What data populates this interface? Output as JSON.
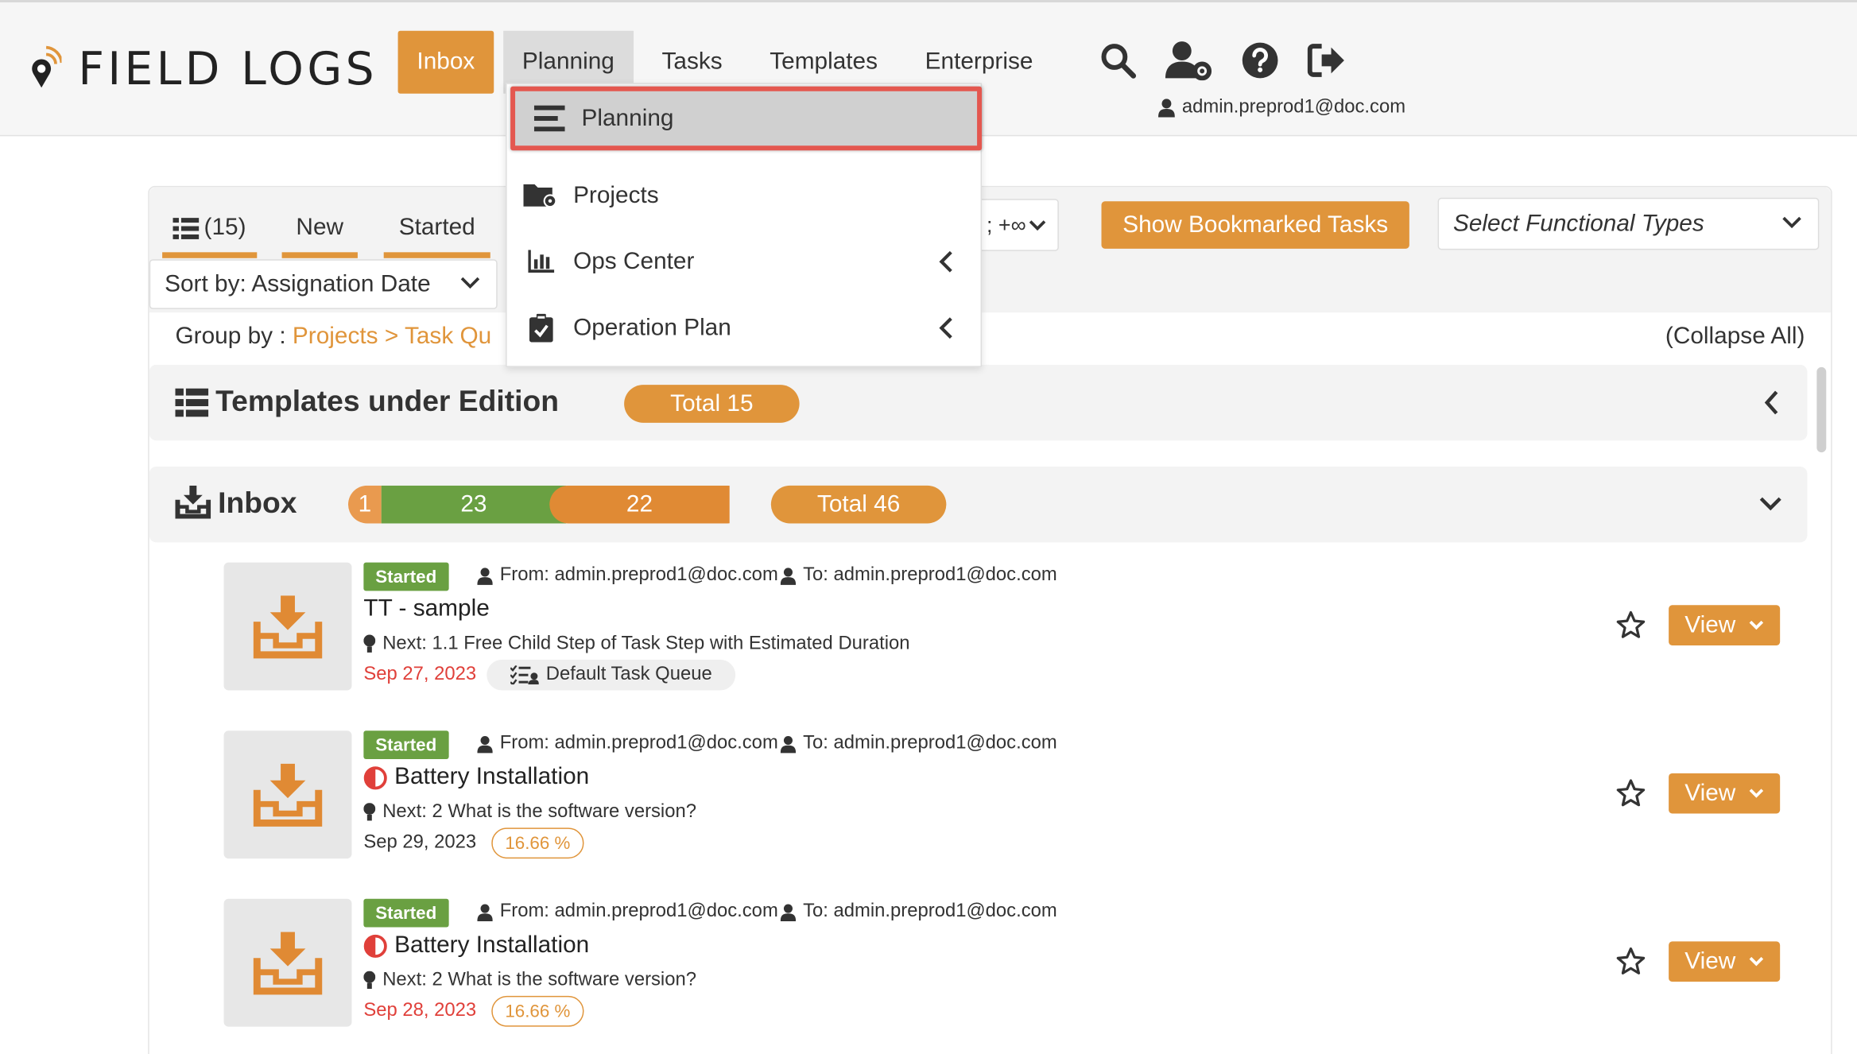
{
  "app": {
    "logo_text": "FIELD LOGS"
  },
  "nav": {
    "items": [
      {
        "label": "Inbox"
      },
      {
        "label": "Planning"
      },
      {
        "label": "Tasks"
      },
      {
        "label": "Templates"
      },
      {
        "label": "Enterprise"
      }
    ],
    "user_email": "admin.preprod1@doc.com",
    "icons": [
      "search-icon",
      "user-settings-icon",
      "help-icon",
      "logout-icon"
    ]
  },
  "dropdown": {
    "items": [
      {
        "label": "Planning",
        "icon": "bars-icon"
      },
      {
        "label": "Projects",
        "icon": "folder-gear-icon"
      },
      {
        "label": "Ops Center",
        "icon": "chart-icon"
      },
      {
        "label": "Operation Plan",
        "icon": "clipboard-check-icon"
      }
    ]
  },
  "toolbar": {
    "count": "(15)",
    "tabs": [
      {
        "label": "New"
      },
      {
        "label": "Started"
      }
    ],
    "sort_label": "Sort by: Assignation Date",
    "range_label": "; +∞",
    "bookmark_button": "Show Bookmarked Tasks",
    "functional_types_placeholder": "Select Functional Types",
    "group_by_label": "Group by :",
    "group_by_value": "Projects > Task Qu",
    "collapse_all": "(Collapse All)"
  },
  "sections": {
    "templates": {
      "title": "Templates under Edition",
      "total": "Total 15"
    },
    "inbox": {
      "title": "Inbox",
      "segments": [
        {
          "value": "1",
          "color": "#e99a4f"
        },
        {
          "value": "23",
          "color": "#6aa042"
        },
        {
          "value": "22",
          "color": "#e08a34"
        }
      ],
      "total": "Total 46"
    }
  },
  "tasks": [
    {
      "status": "Started",
      "from": "From: admin.preprod1@doc.com",
      "to": "To: admin.preprod1@doc.com",
      "name": "TT - sample",
      "next": "Next: 1.1 Free Child Step of Task Step with Estimated Duration",
      "date": "Sep 27, 2023",
      "queue": "Default Task Queue",
      "view": "View"
    },
    {
      "status": "Started",
      "from": "From: admin.preprod1@doc.com",
      "to": "To: admin.preprod1@doc.com",
      "name": "Battery Installation",
      "next": "Next: 2  What is the software version?",
      "date": "Sep 29, 2023",
      "progress": "16.66 %",
      "view": "View"
    },
    {
      "status": "Started",
      "from": "From: admin.preprod1@doc.com",
      "to": "To: admin.preprod1@doc.com",
      "name": "Battery Installation",
      "next": "Next: 2  What is the software version?",
      "date": "Sep 28, 2023",
      "progress": "16.66 %",
      "view": "View"
    }
  ]
}
